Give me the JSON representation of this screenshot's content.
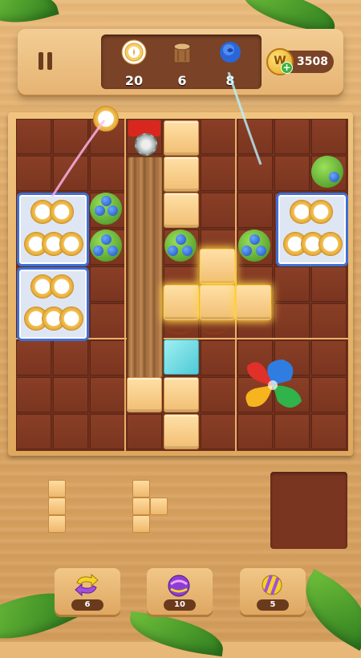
{
  "header": {
    "goals": [
      {
        "icon": "plate-icon",
        "count": "20"
      },
      {
        "icon": "wood-stump-icon",
        "count": "6"
      },
      {
        "icon": "blue-rose-icon",
        "count": "8"
      }
    ],
    "coins": {
      "icon_letter": "W",
      "value": "3508"
    }
  },
  "boosters": [
    {
      "icon": "swap-arrows-icon",
      "count": "6"
    },
    {
      "icon": "purple-ball-icon",
      "count": "10"
    },
    {
      "icon": "striped-ball-icon",
      "count": "5"
    }
  ],
  "colors": {
    "board_cell": "#8a3f26",
    "wood_block": "#f1be73",
    "tray_border": "#3f6fd6",
    "coin": "#e6a51e"
  }
}
